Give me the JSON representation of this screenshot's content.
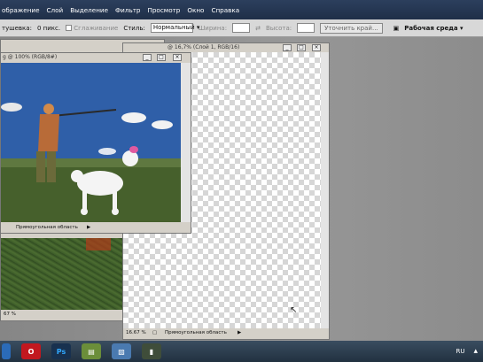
{
  "menu": [
    "ображение",
    "Слой",
    "Выделение",
    "Фильтр",
    "Просмотр",
    "Окно",
    "Справка"
  ],
  "options": {
    "feather_label": "тушевка:",
    "feather_value": "0 пикс.",
    "antialias_label": "Сглаживание",
    "style_label": "Стиль:",
    "style_value": "Нормальный",
    "width_label": "Ширина:",
    "height_label": "Высота:",
    "refine_button": "Уточнить край...",
    "workspace_button": "Рабочая среда"
  },
  "windows": {
    "photo": {
      "title": "g @ 100% (RGB/8#)",
      "status": "Прямоугольная область"
    },
    "canvas": {
      "title": "@ 16,7% (Слой 1, RGB/16)",
      "zoom": "16.67 %",
      "status": "Прямоугольная область"
    },
    "back": {
      "zoom": "67 %"
    }
  },
  "taskbar": {
    "items": [
      "opera-icon",
      "photoshop-icon",
      "folder-icon",
      "image-viewer-icon",
      "app-icon"
    ],
    "ps_label": "Ps",
    "lang": "RU"
  },
  "colors": {
    "menubar": "#1f2f48",
    "taskbar": "#223140",
    "sky": "#2f5fa8",
    "grass": "#46602c"
  }
}
